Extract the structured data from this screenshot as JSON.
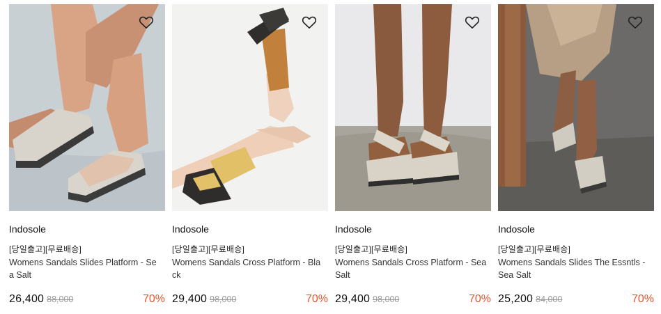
{
  "products": [
    {
      "brand": "Indosole",
      "tag": "[당일출고][무료배송]",
      "name": "Womens Sandals Slides Platform - Sea Salt",
      "price": "26,400",
      "original_price": "88,000",
      "discount": "70%",
      "wishlist_icon": "heart-outline-icon"
    },
    {
      "brand": "Indosole",
      "tag": "[당일출고][무료배송]",
      "name": "Womens Sandals Cross Platform - Black",
      "price": "29,400",
      "original_price": "98,000",
      "discount": "70%",
      "wishlist_icon": "heart-outline-icon"
    },
    {
      "brand": "Indosole",
      "tag": "[당일출고][무료배송]",
      "name": "Womens Sandals Cross Platform - Sea Salt",
      "price": "29,400",
      "original_price": "98,000",
      "discount": "70%",
      "wishlist_icon": "heart-outline-icon"
    },
    {
      "brand": "Indosole",
      "tag": "[당일출고][무료배송]",
      "name": "Womens Sandals Slides The Essntls - Sea Salt",
      "price": "25,200",
      "original_price": "84,000",
      "discount": "70%",
      "wishlist_icon": "heart-outline-icon"
    }
  ],
  "colors": {
    "discount": "#e8532f",
    "strike": "#999999"
  }
}
